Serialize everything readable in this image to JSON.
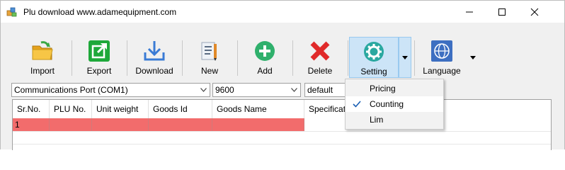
{
  "window": {
    "title": "Plu download www.adamequipment.com"
  },
  "toolbar": {
    "import_label": "Import",
    "export_label": "Export",
    "download_label": "Download",
    "new_label": "New",
    "add_label": "Add",
    "delete_label": "Delete",
    "setting_label": "Setting",
    "language_label": "Language"
  },
  "combos": {
    "port": "Communications Port (COM1)",
    "baud": "9600",
    "mode": "default"
  },
  "grid": {
    "columns": [
      "Sr.No.",
      "PLU No.",
      "Unit weight",
      "Goods Id",
      "Goods Name",
      "Specification"
    ],
    "rows": [
      [
        "1",
        "",
        "",
        "",
        "",
        ""
      ]
    ],
    "selected_row_color": "#f26c6c"
  },
  "setting_menu": {
    "items": [
      {
        "label": "Pricing",
        "checked": false
      },
      {
        "label": "Counting",
        "checked": true
      },
      {
        "label": "Lim",
        "checked": false
      }
    ]
  },
  "colors": {
    "accent": "#cce4f7",
    "export_green": "#1ea83a",
    "add_green": "#2fb06c",
    "delete_red": "#e02a2a",
    "setting_teal": "#2aa8a0"
  }
}
